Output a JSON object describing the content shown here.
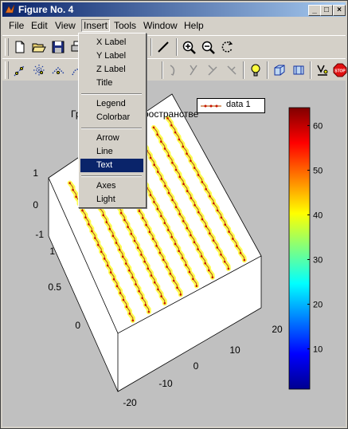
{
  "window": {
    "title": "Figure No. 4",
    "controls": [
      "_",
      "□",
      "×"
    ]
  },
  "menubar": {
    "items": [
      "File",
      "Edit",
      "View",
      "Insert",
      "Tools",
      "Window",
      "Help"
    ],
    "open_menu": "Insert"
  },
  "insert_menu": {
    "items": [
      "X Label",
      "Y Label",
      "Z Label",
      "Title",
      "Legend",
      "Colorbar",
      "Arrow",
      "Line",
      "Text",
      "Axes",
      "Light"
    ],
    "selected": "Text"
  },
  "toolbar1": {
    "icons": [
      "new-file-icon",
      "open-folder-icon",
      "save-icon",
      "print-icon",
      "draw-line-icon",
      "zoom-in-icon",
      "zoom-out-icon",
      "rotate-3d-icon"
    ]
  },
  "toolbar2": {
    "icons": [
      "edit-points-icon",
      "select-points-icon",
      "pan-icon",
      "rotate-icon",
      "light-bulb-icon",
      "box-3d-icon",
      "box-frame-icon",
      "data-labels-icon",
      "stop-icon"
    ]
  },
  "plot": {
    "title": "Гр             ды в пространстве",
    "legend": "data 1",
    "colors": {
      "data_line": "#c0641e",
      "data_marker": "#c81400",
      "glow": "#ffff3c"
    }
  },
  "chart_data": {
    "type": "scatter",
    "title": "Гр             ды в пространстве",
    "legend": [
      "data 1"
    ],
    "axes": {
      "x_ticks": [
        -20,
        -10,
        0,
        10,
        20
      ],
      "y_ticks": [
        -20,
        -10,
        0,
        10,
        20
      ],
      "z_ticks": [
        -1,
        0,
        1
      ],
      "floor_ticks": [
        0,
        0.5,
        1
      ],
      "xlim": [
        -20,
        20
      ],
      "ylim": [
        -20,
        20
      ],
      "zlim": [
        -1,
        1
      ]
    },
    "series": [
      {
        "name": "data 1",
        "lines": 8
      }
    ],
    "colorbar": {
      "ticks": [
        10,
        20,
        30,
        40,
        50,
        60
      ],
      "range": [
        1,
        64
      ],
      "colormap": "jet"
    }
  }
}
